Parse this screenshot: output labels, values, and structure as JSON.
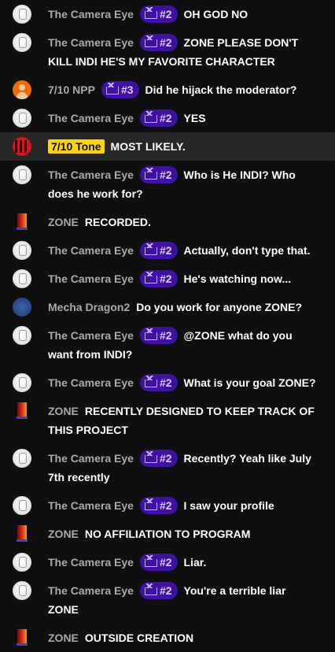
{
  "colors": {
    "background": "#0f0f0f",
    "highlight_row": "#272727",
    "member_badge": "#3d10a8",
    "owner_tag": "#ffd600"
  },
  "messages": [
    {
      "author": "The Camera Eye",
      "avatar": "camera-eye",
      "badge": "#2",
      "text": "OH GOD NO"
    },
    {
      "author": "The Camera Eye",
      "avatar": "camera-eye",
      "badge": "#2",
      "text": "ZONE PLEASE DON'T KILL INDI HE'S MY FAVORITE CHARACTER"
    },
    {
      "author": "7/10 NPP",
      "avatar": "npp",
      "badge": "#3",
      "text": "Did he hijack the moderator?"
    },
    {
      "author": "The Camera Eye",
      "avatar": "camera-eye",
      "badge": "#2",
      "text": "YES"
    },
    {
      "author": "7/10 Tone",
      "avatar": "tone",
      "owner": true,
      "text": "MOST LIKELY."
    },
    {
      "author": "The Camera Eye",
      "avatar": "camera-eye",
      "badge": "#2",
      "text": "Who is He INDI? Who does he work for?"
    },
    {
      "author": "ZONE",
      "avatar": "zone",
      "text": "RECORDED."
    },
    {
      "author": "The Camera Eye",
      "avatar": "camera-eye",
      "badge": "#2",
      "text": "Actually, don't type that."
    },
    {
      "author": "The Camera Eye",
      "avatar": "camera-eye",
      "badge": "#2",
      "text": "He's watching now..."
    },
    {
      "author": "Mecha Dragon2",
      "avatar": "mecha",
      "text": "Do you work for anyone ZONE?"
    },
    {
      "author": "The Camera Eye",
      "avatar": "camera-eye",
      "badge": "#2",
      "text": "@ZONE what do you want from INDI?"
    },
    {
      "author": "The Camera Eye",
      "avatar": "camera-eye",
      "badge": "#2",
      "text": "What is your goal ZONE?"
    },
    {
      "author": "ZONE",
      "avatar": "zone",
      "text": "RECENTLY DESIGNED TO KEEP TRACK OF THIS PROJECT"
    },
    {
      "author": "The Camera Eye",
      "avatar": "camera-eye",
      "badge": "#2",
      "text": "Recently? Yeah like July 7th recently"
    },
    {
      "author": "The Camera Eye",
      "avatar": "camera-eye",
      "badge": "#2",
      "text": "I saw your profile"
    },
    {
      "author": "ZONE",
      "avatar": "zone",
      "text": "NO AFFILIATION TO PROGRAM"
    },
    {
      "author": "The Camera Eye",
      "avatar": "camera-eye",
      "badge": "#2",
      "text": "Liar."
    },
    {
      "author": "The Camera Eye",
      "avatar": "camera-eye",
      "badge": "#2",
      "text": "You're a terrible liar ZONE"
    },
    {
      "author": "ZONE",
      "avatar": "zone",
      "text": "OUTSIDE CREATION"
    }
  ]
}
